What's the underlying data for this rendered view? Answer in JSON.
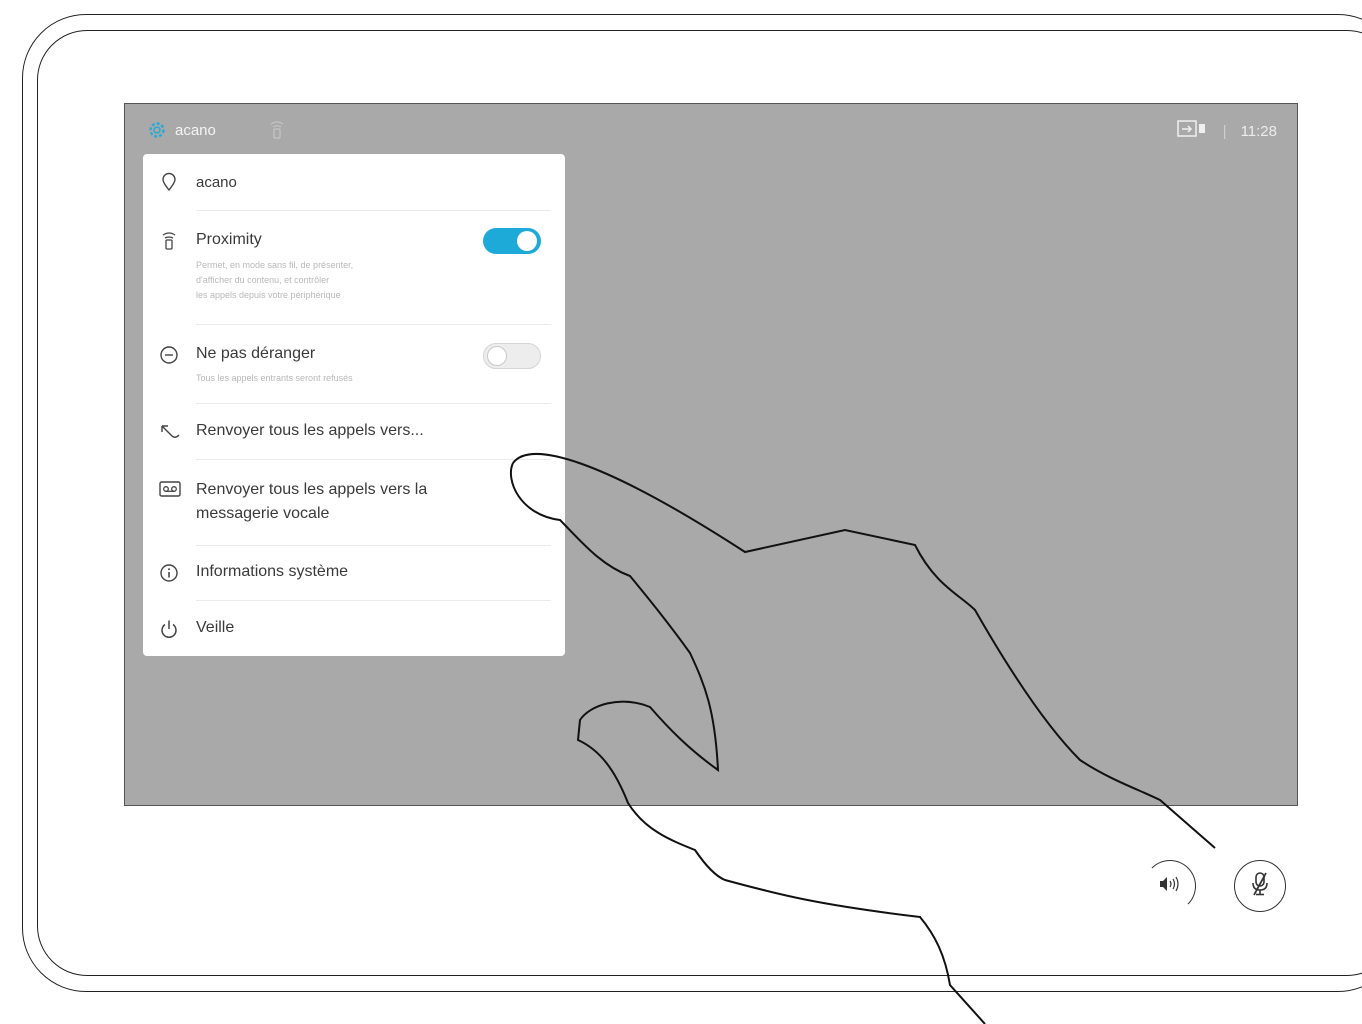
{
  "status_bar": {
    "device_name": "acano",
    "clock": "11:28",
    "divider": "|"
  },
  "menu": {
    "location": {
      "label": "acano",
      "icon": "location-pin-icon"
    },
    "proximity": {
      "label": "Proximity",
      "description_lines": [
        "Permet, en mode sans fil, de présenter,",
        "d'afficher du contenu, et contrôler",
        "les appels depuis votre périphérique"
      ],
      "enabled": true,
      "icon": "proximity-icon"
    },
    "do_not_disturb": {
      "label": "Ne pas déranger",
      "description": "Tous les appels entrants seront refusés",
      "enabled": false,
      "icon": "minus-circle-icon"
    },
    "forward_calls": {
      "label": "Renvoyer tous les appels vers...",
      "icon": "call-forward-icon"
    },
    "forward_voicemail": {
      "label_lines": [
        "Renvoyer tous les appels vers la",
        "messagerie vocale"
      ],
      "icon": "voicemail-icon"
    },
    "system_info": {
      "label": "Informations système",
      "icon": "info-icon"
    },
    "standby": {
      "label": "Veille",
      "icon": "power-icon"
    }
  },
  "controls": {
    "volume": {
      "icon": "speaker-icon"
    },
    "mute": {
      "icon": "microphone-muted-icon"
    }
  },
  "colors": {
    "accent": "#1eaad9",
    "screen": "#a9a9a9"
  }
}
